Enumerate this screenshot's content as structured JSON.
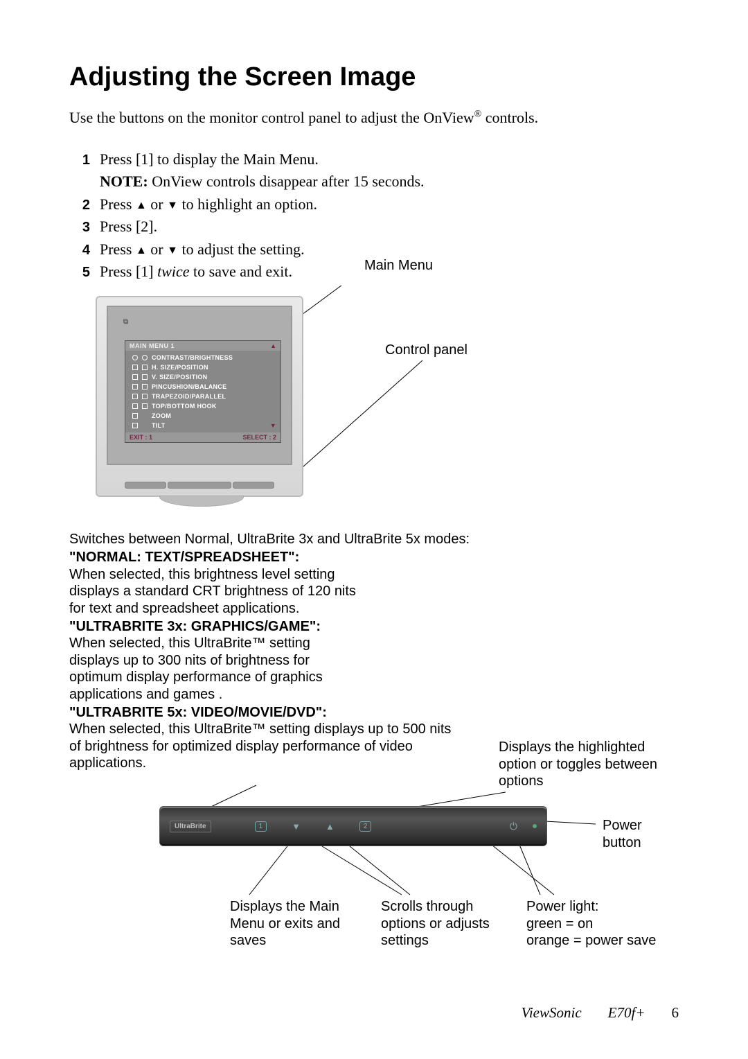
{
  "title": "Adjusting the Screen Image",
  "intro_before": "Use the buttons on the monitor control panel to adjust the OnView",
  "intro_reg": "®",
  "intro_after": " controls.",
  "steps": {
    "n1": "1",
    "t1": "Press [1] to display the Main Menu.",
    "note_b": "NOTE:",
    "note_t": " OnView controls disappear after 15 seconds.",
    "n2": "2",
    "t2_a": "Press ",
    "t2_mid": " or ",
    "t2_b": " to highlight an option.",
    "up": "▲",
    "down": "▼",
    "n3": "3",
    "t3": "Press [2].",
    "n4": "4",
    "t4_a": "Press ",
    "t4_mid": " or ",
    "t4_b": " to adjust the setting.",
    "n5": "5",
    "t5_a": "Press [1] ",
    "t5_twice": "twice",
    "t5_b": " to save and exit."
  },
  "callout": {
    "main_menu": "Main Menu",
    "control_panel": "Control panel"
  },
  "osd": {
    "header": "MAIN MENU 1",
    "items": [
      "CONTRAST/BRIGHTNESS",
      "H. SIZE/POSITION",
      "V. SIZE/POSITION",
      "PINCUSHION/BALANCE",
      "TRAPEZOID/PARALLEL",
      "TOP/BOTTOM HOOK",
      "ZOOM",
      "TILT"
    ],
    "footer_l": "EXIT : 1",
    "footer_r": "SELECT : 2"
  },
  "modes": {
    "intro": "Switches between Normal, UltraBrite 3x and UltraBrite 5x modes:",
    "m1_title": "\"NORMAL: TEXT/SPREADSHEET\":",
    "m1_body": "When selected, this brightness level setting displays a standard CRT brightness of 120 nits for text and spreadsheet applications.",
    "m2_title": "\"ULTRABRITE  3x: GRAPHICS/GAME\":",
    "m2_body": "When selected, this UltraBrite™ setting displays up to 300 nits of brightness for optimum display performance of graphics applications and games .",
    "m3_title": "\"ULTRABRITE  5x:  VIDEO/MOVIE/DVD\":",
    "m3_body": "When selected, this UltraBrite™ setting displays up to 500 nits of brightness for optimized display performance of video applications."
  },
  "panel": {
    "ultrabrite": "UltraBrite",
    "btn1": "1",
    "btn_down": "▼",
    "btn_up": "▲",
    "btn2": "2",
    "power_icon": "⏻",
    "label_display_option": "Displays  the  highlighted option or toggles between options",
    "label_power_button": "Power button",
    "label_main": "Displays the Main Menu or exits and saves",
    "label_scroll": "Scrolls through options or adjusts settings",
    "label_power_light": "Power light:",
    "label_green": "green = on",
    "label_orange": "orange = power save"
  },
  "footer": {
    "brand": "ViewSonic",
    "model": "E70f+",
    "page": "6"
  }
}
